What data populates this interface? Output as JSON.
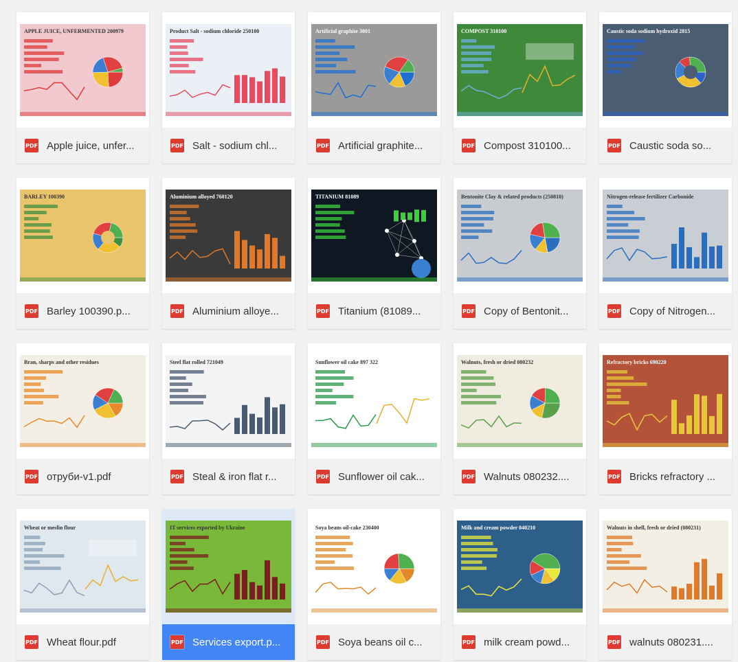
{
  "file_type_badge": "PDF",
  "selected_index": 16,
  "colors": {
    "accent": "#4285f4",
    "pdf_red": "#dd3b30",
    "text": "#333333",
    "background": "#f1f1f1"
  },
  "files": [
    {
      "name": "Apple juice, unfer...",
      "thumb": {
        "title": "APPLE JUICE, UNFERMENTED 200979",
        "bg": "#f2c9cf",
        "accent": "#e03a3a",
        "style": "pie"
      }
    },
    {
      "name": "Salt - sodium chl...",
      "thumb": {
        "title": "Product Salt - sodium chloride 250100",
        "bg": "#eaf0f6",
        "accent": "#e84a5f",
        "style": "bars"
      }
    },
    {
      "name": "Artificial graphite...",
      "thumb": {
        "title": "Artificial graphite 3801",
        "bg": "#9a9a9a",
        "accent": "#1f6fd1",
        "style": "pie"
      }
    },
    {
      "name": "Compost 310100...",
      "thumb": {
        "title": "COMPOST 310100",
        "bg": "#3f8a3a",
        "accent": "#6fb0e0",
        "style": "line"
      }
    },
    {
      "name": "Caustic soda so...",
      "thumb": {
        "title": "Caustic soda sodium hydroxid 2815",
        "bg": "#4a5d73",
        "accent": "#2a62c9",
        "style": "donut"
      }
    },
    {
      "name": "Barley 100390.p...",
      "thumb": {
        "title": "BARLEY 100390",
        "bg": "#e9c46a",
        "accent": "#3f8f3f",
        "style": "donut"
      }
    },
    {
      "name": "Aluminium alloye...",
      "thumb": {
        "title": "Aluminium alloyed 760120",
        "bg": "#3a3a3a",
        "accent": "#e07a2a",
        "style": "bars"
      }
    },
    {
      "name": "Titanium (81089...",
      "thumb": {
        "title": "TITANIUM 81089",
        "bg": "#0f1822",
        "accent": "#3bcf3b",
        "style": "network"
      }
    },
    {
      "name": "Copy of Bentonit...",
      "thumb": {
        "title": "Bentonite Clay & related products (250810)",
        "bg": "#c8ccd0",
        "accent": "#2a6fbf",
        "style": "pie"
      }
    },
    {
      "name": "Copy of Nitrogen...",
      "thumb": {
        "title": "Nitrogen-release fertilizer Carbonide",
        "bg": "#c9ced4",
        "accent": "#2a6fbf",
        "style": "bars"
      }
    },
    {
      "name": "отруби-v1.pdf",
      "thumb": {
        "title": "Bran, sharps and other residues",
        "bg": "#f4efe4",
        "accent": "#e88a2a",
        "style": "pie"
      }
    },
    {
      "name": "Steal & iron flat r...",
      "thumb": {
        "title": "Steel flat rolled 721049",
        "bg": "#f4f4f4",
        "accent": "#4a5a70",
        "style": "bars"
      }
    },
    {
      "name": "Sunflower oil cak...",
      "thumb": {
        "title": "Sunflower oil cake 897 322",
        "bg": "#ffffff",
        "accent": "#2a9a4a",
        "style": "line"
      }
    },
    {
      "name": "Walnuts 080232....",
      "thumb": {
        "title": "Walnuts, fresh or dried 080232",
        "bg": "#f1ece0",
        "accent": "#5aa04a",
        "style": "pie"
      }
    },
    {
      "name": "Bricks refractory ...",
      "thumb": {
        "title": "Refractory bricks 690220",
        "bg": "#b5533a",
        "accent": "#e8c83a",
        "style": "bars"
      }
    },
    {
      "name": "Wheat flour.pdf",
      "thumb": {
        "title": "Wheat or meslin flour",
        "bg": "#dfe7ef",
        "accent": "#8aa0b8",
        "style": "line"
      }
    },
    {
      "name": "Services export.p...",
      "thumb": {
        "title": "IT services exported by Ukraine",
        "bg": "#7ab83a",
        "accent": "#7a1f1f",
        "style": "bars"
      }
    },
    {
      "name": "Soya beans oil c...",
      "thumb": {
        "title": "Soya beans oil-cake 230400",
        "bg": "#ffffff",
        "accent": "#e08a2a",
        "style": "pie"
      }
    },
    {
      "name": "milk cream powd...",
      "thumb": {
        "title": "Milk and cream powder 040210",
        "bg": "#2e5f8a",
        "accent": "#e8e83a",
        "style": "pie"
      }
    },
    {
      "name": "walnuts 080231....",
      "thumb": {
        "title": "Walnuts in shell, fresh or dried (080231)",
        "bg": "#f4efe4",
        "accent": "#e07a2a",
        "style": "bars"
      }
    }
  ]
}
